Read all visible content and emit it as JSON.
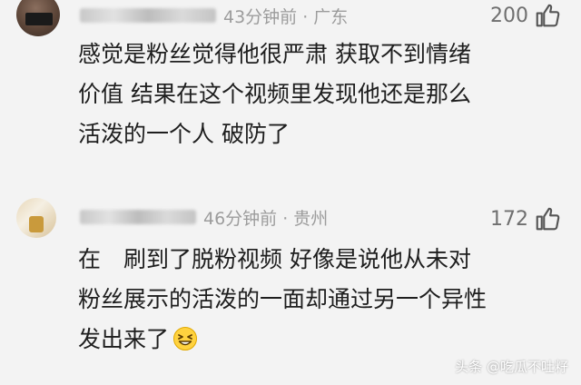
{
  "comments": [
    {
      "meta": "43分钟前 · 广东",
      "likes": "200",
      "lines": [
        "感觉是粉丝觉得他很严肃 获取不到情绪",
        "价值 结果在这个视频里发现他还是那么",
        "活泼的一个人 破防了"
      ]
    },
    {
      "meta": "46分钟前 · 贵州",
      "likes": "172",
      "lines": [
        "在　刷到了脱粉视频 好像是说他从未对",
        "粉丝展示的活泼的一面却通过另一个异性",
        "发出来了"
      ],
      "emoji": "grinning-squint-emoji"
    }
  ],
  "watermark": "头条 @吃瓜不吐籽",
  "colors": {
    "background": "#f3f3f3",
    "text": "#1e1e1e",
    "meta": "#9c9c9c",
    "like_count": "#6f6f6f"
  }
}
